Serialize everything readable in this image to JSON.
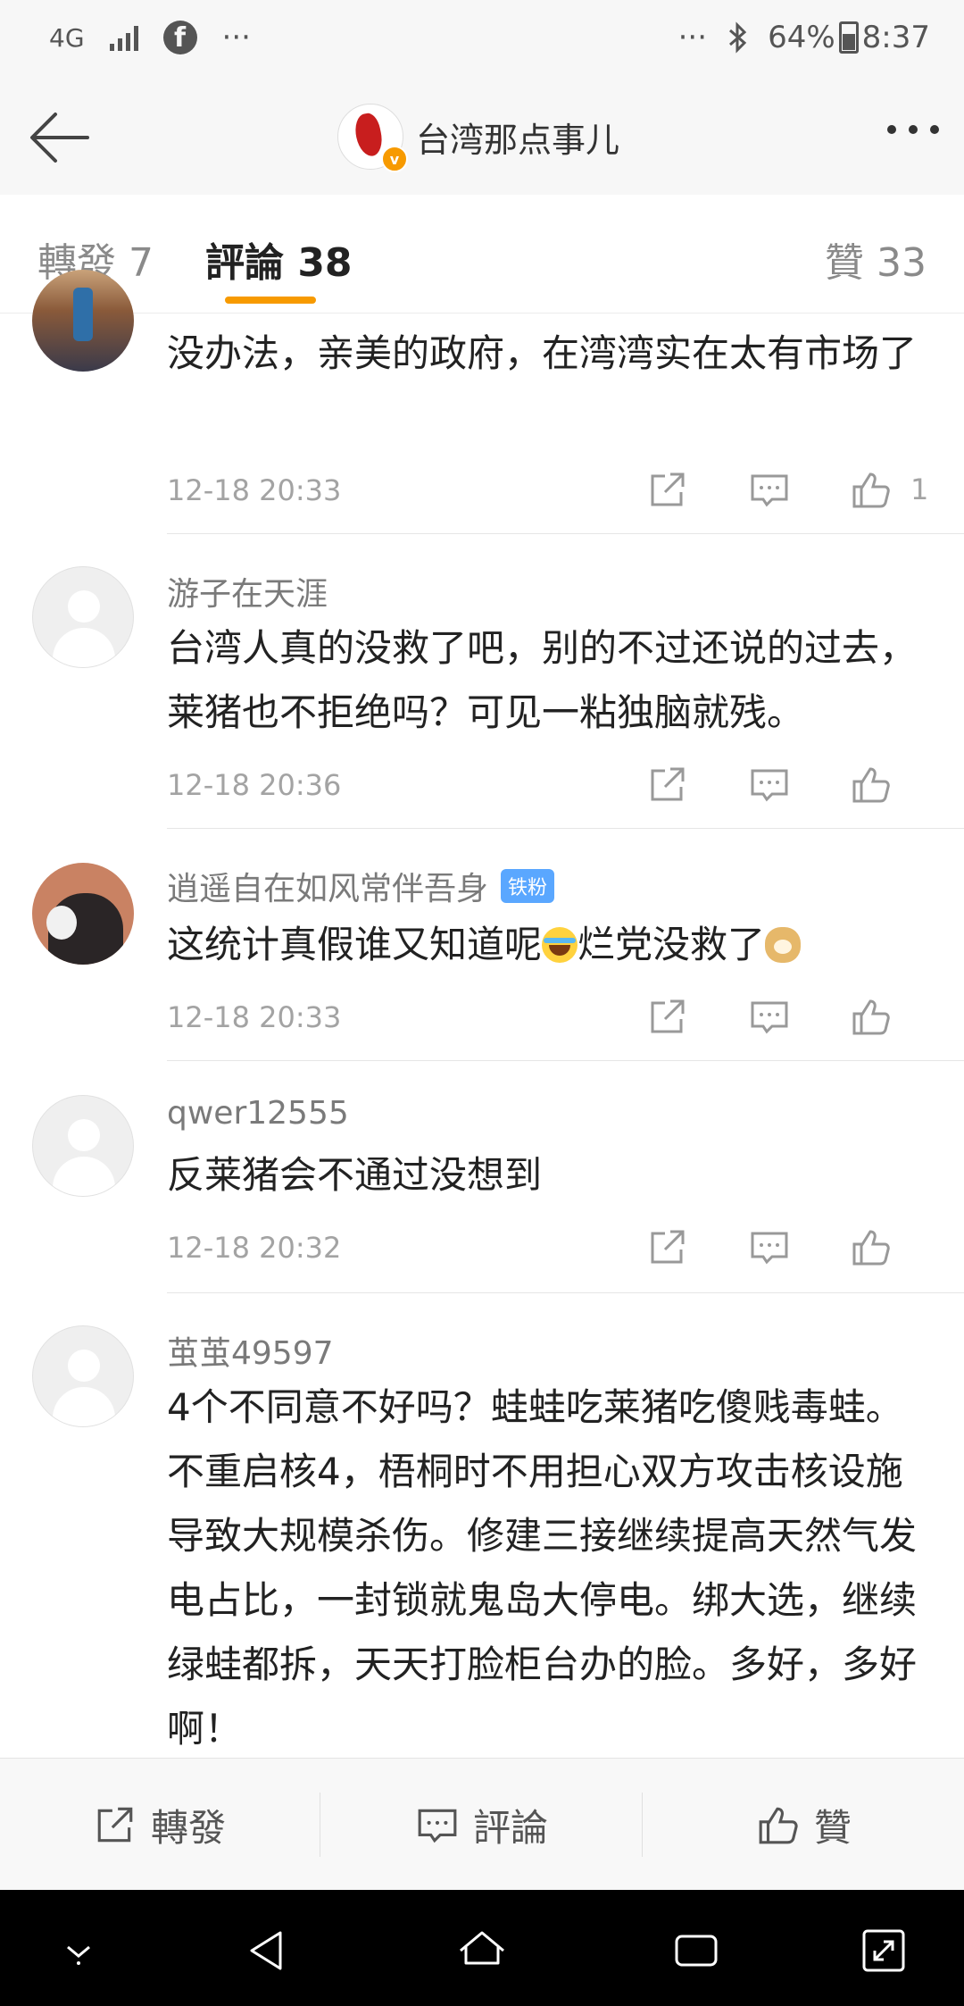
{
  "status_bar": {
    "network": "4G",
    "more": "···",
    "more_right": "···",
    "battery": "64%",
    "time": "8:37"
  },
  "header": {
    "title": "台湾那点事儿"
  },
  "tabs": [
    {
      "label": "轉發 7"
    },
    {
      "label": "評論 38"
    },
    {
      "label": "贊 33"
    }
  ],
  "comments": [
    {
      "username": "",
      "text": "没办法，亲美的政府，在湾湾实在太有市场了",
      "time": "12-18 20:33",
      "likes": "1"
    },
    {
      "username": "游子在天涯",
      "text": "台湾人真的没救了吧，别的不过还说的过去，莱猪也不拒绝吗？可见一粘独脑就残。",
      "time": "12-18 20:36",
      "likes": ""
    },
    {
      "username": "逍遥自在如风常伴吾身",
      "badge": "铁粉",
      "text_a": "这统计真假谁又知道呢",
      "text_b": "烂党没救了",
      "time": "12-18 20:33",
      "likes": ""
    },
    {
      "username": "qwer12555",
      "text": "反莱猪会不通过没想到",
      "time": "12-18 20:32",
      "likes": ""
    },
    {
      "username": "茧茧49597",
      "text": "4个不同意不好吗？蛙蛙吃莱猪吃傻贱毒蛙。不重启核4，梧桐时不用担心双方攻击核设施导致大规模杀伤。修建三接继续提高天然气发电占比，一封锁就鬼岛大停电。绑大选，继续绿蛙都拆，天天打脸柜台办的脸。多好，多好啊！"
    }
  ],
  "bottom_bar": {
    "repost": "轉發",
    "comment": "評論",
    "like": "贊"
  },
  "colors": {
    "accent": "#f79a00",
    "badge": "#5aa7ff"
  }
}
